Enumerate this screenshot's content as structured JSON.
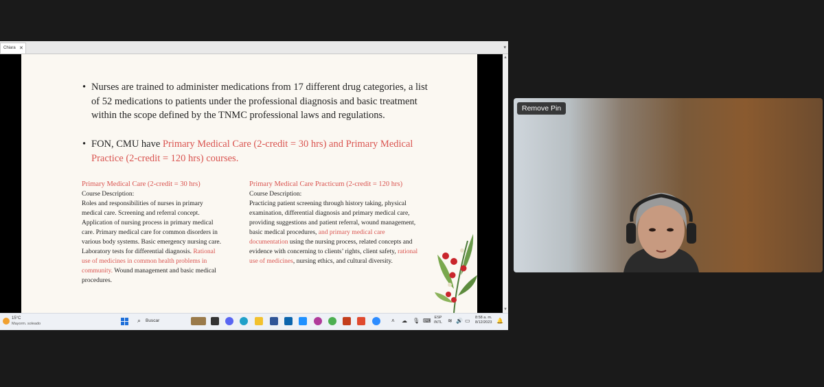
{
  "tab": {
    "title": "Chiara",
    "close": "✕"
  },
  "slide": {
    "bullet1": "Nurses are trained to administer medications from 17 different drug categories, a list of 52 medications to patients under the professional diagnosis and basic treatment within the scope defined by the TNMC professional laws and regulations.",
    "bullet2_plain": "FON, CMU have ",
    "bullet2_red": "Primary Medical Care (2-credit = 30 hrs) and Primary Medical Practice (2-credit = 120 hrs) courses.",
    "left_col": {
      "heading": "Primary Medical Care (2-credit = 30 hrs)",
      "sub": "Course Description:",
      "text1": "Roles and responsibilities of nurses in primary medical care. Screening and referral concept. Application of nursing process in primary medical care. Primary medical care for common disorders in various body systems. Basic emergency nursing care. Laboratory tests for differential diagnosis. ",
      "red1": "Rational use of medicines in common health problems in community.",
      "text2": " Wound management and basic medical procedures."
    },
    "right_col": {
      "heading": "Primary Medical Care Practicum (2-credit = 120 hrs)",
      "sub": "Course Description:",
      "text1": "Practicing patient screening through history taking, physical examination, differential diagnosis and primary medical care, providing suggestions and patient referral, wound management, basic medical procedures, ",
      "red1": "and primary medical care documentation",
      "text2": " using the nursing process, related concepts and evidence with concerning to clients’ rights, client safety, ",
      "red2": "rational use of medicines",
      "text3": ", nursing ethics, and cultural diversity."
    }
  },
  "taskbar": {
    "temp": "15°C",
    "weather": "Mayorm. soleado",
    "search": "Buscar",
    "lang_top": "ESP",
    "lang_bottom": "INTL",
    "time": "8:58 a. m.",
    "date": "8/12/2023"
  },
  "video": {
    "remove_pin": "Remove Pin"
  },
  "colors": {
    "accent_red": "#d9534f",
    "windows_blue": "#1e6fd9"
  }
}
